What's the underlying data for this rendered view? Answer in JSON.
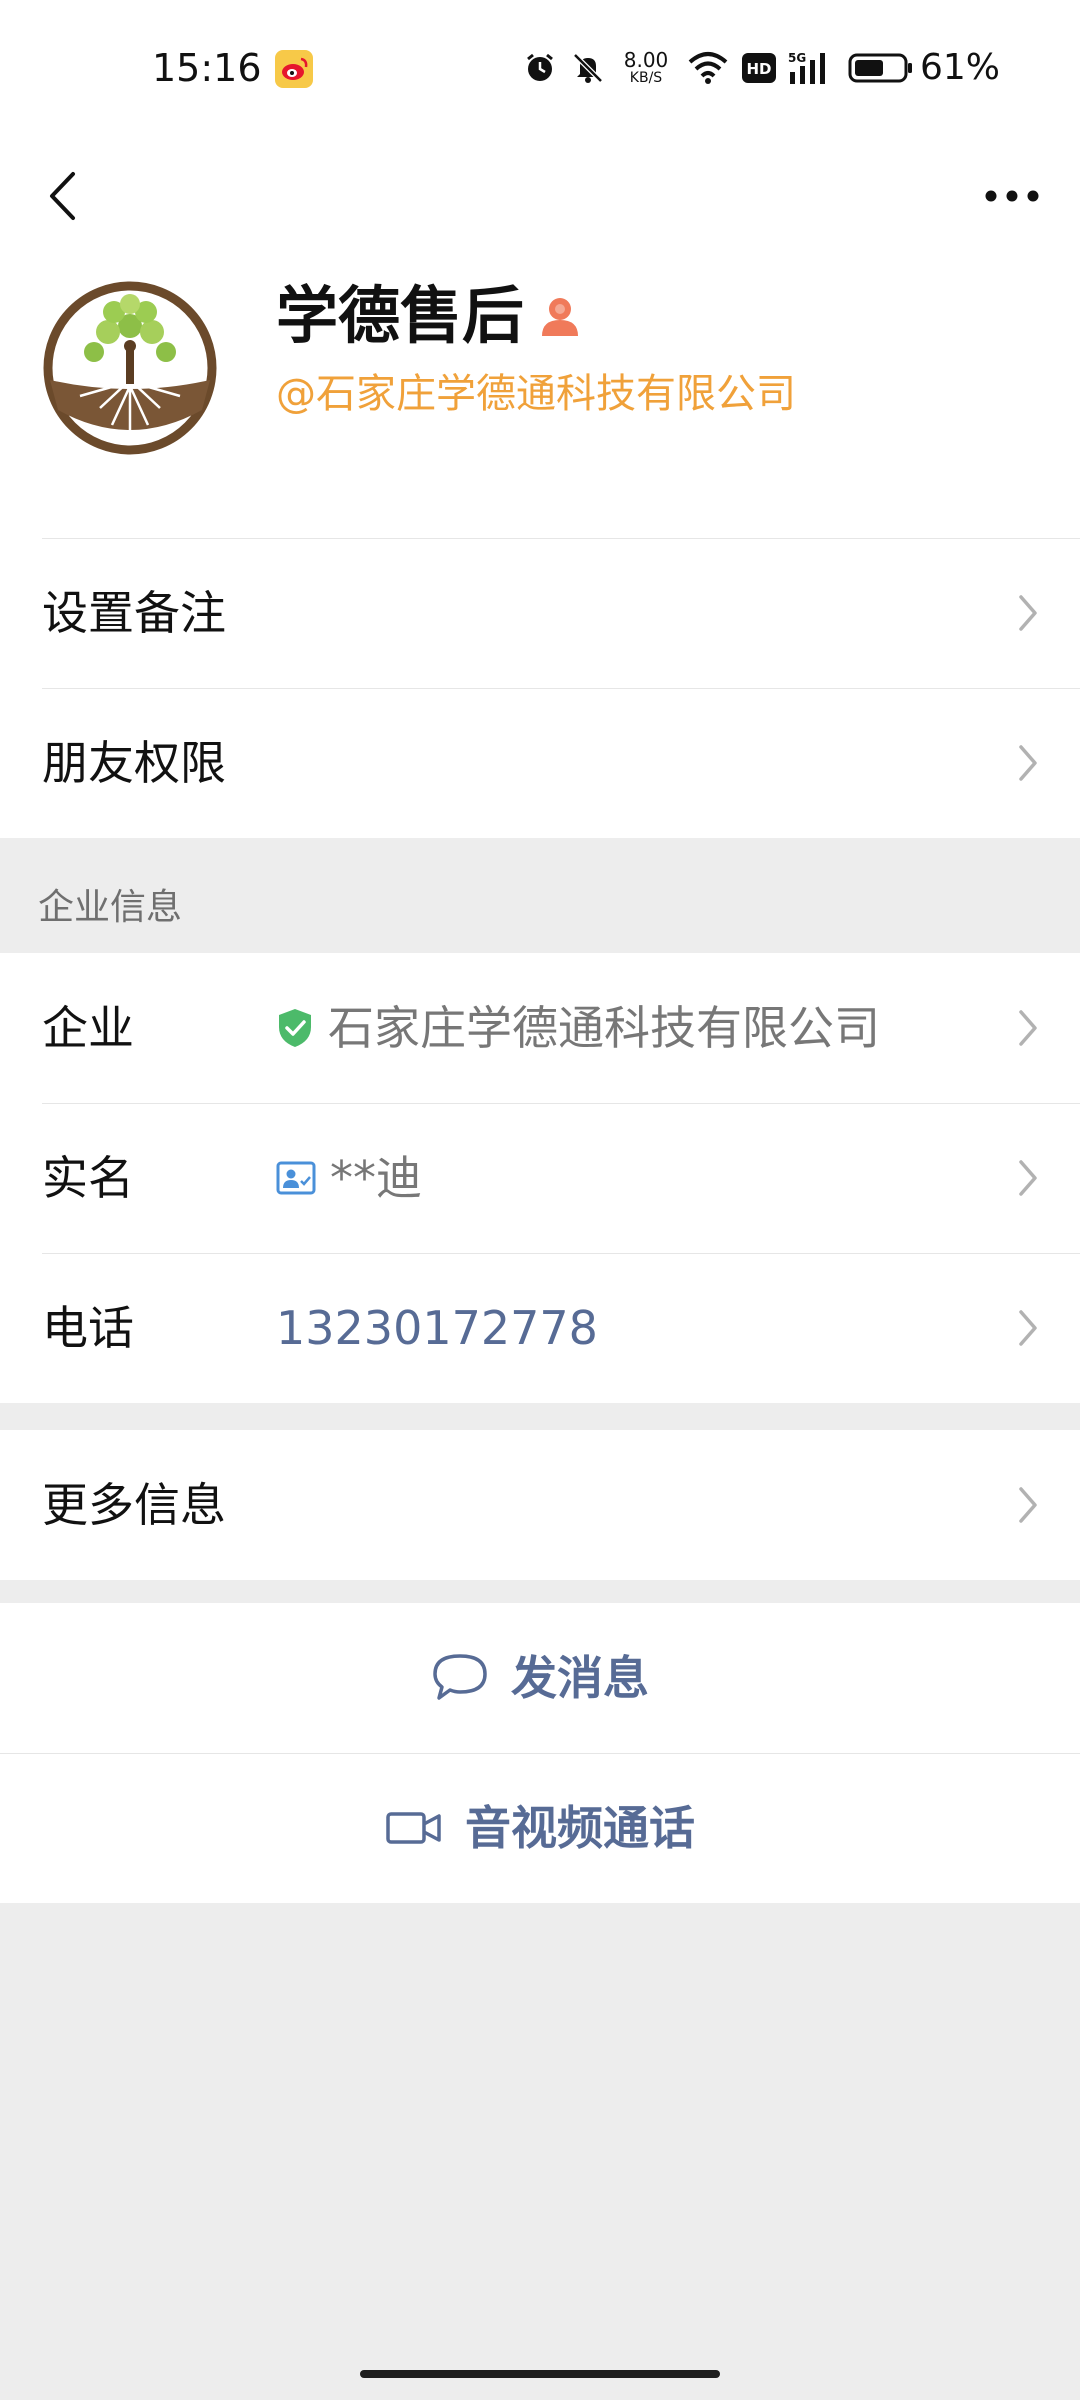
{
  "status_bar": {
    "time": "15:16",
    "net_speed_value": "8.00",
    "net_speed_unit": "KB/S",
    "network_type": "5G",
    "hd_label": "HD",
    "battery_percent": "61%",
    "battery_level": 0.61,
    "icons": [
      "weibo-icon",
      "alarm-icon",
      "mute-icon",
      "wifi-icon",
      "hd-icon",
      "signal-icon",
      "battery-icon"
    ]
  },
  "nav": {
    "back_icon": "chevron-left-icon",
    "more_icon": "more-dots-icon"
  },
  "profile": {
    "name": "学德售后",
    "company_tag": "@石家庄学德通科技有限公司",
    "gender_icon": "person-icon",
    "colors": {
      "company_tag": "#f0a13a",
      "gender_icon": "#f07a5a"
    }
  },
  "settings": {
    "remark_label": "设置备注",
    "permissions_label": "朋友权限"
  },
  "enterprise": {
    "section_title": "企业信息",
    "company_label": "企业",
    "company_value": "石家庄学德通科技有限公司",
    "company_icon": "verified-shield-icon",
    "realname_label": "实名",
    "realname_value": "**迪",
    "realname_icon": "id-card-icon",
    "phone_label": "电话",
    "phone_value": "13230172778"
  },
  "more": {
    "label": "更多信息"
  },
  "actions": {
    "message_label": "发消息",
    "message_icon": "chat-bubble-icon",
    "call_label": "音视频通话",
    "call_icon": "video-camera-icon",
    "link_color": "#576b95"
  }
}
